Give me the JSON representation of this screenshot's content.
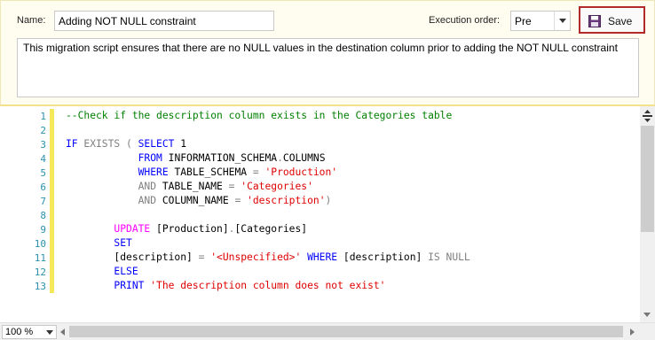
{
  "form": {
    "name_label": "Name:",
    "name_value": "Adding NOT NULL constraint",
    "exec_label": "Execution order:",
    "exec_value": "Pre",
    "save_label": "Save",
    "description": "This migration script ensures that there are no NULL values in the destination column prior to adding the NOT NULL constraint"
  },
  "editor": {
    "zoom": "100 %",
    "lines": [
      {
        "n": "1",
        "tokens": [
          {
            "c": "cmt",
            "t": "--Check if the description column exists in the Categories table"
          }
        ]
      },
      {
        "n": "2",
        "tokens": []
      },
      {
        "n": "3",
        "tokens": [
          {
            "c": "kw",
            "t": "IF "
          },
          {
            "c": "gray",
            "t": "EXISTS ( "
          },
          {
            "c": "kw",
            "t": "SELECT "
          },
          {
            "c": "plain",
            "t": "1"
          }
        ]
      },
      {
        "n": "4",
        "tokens": [
          {
            "c": "plain",
            "t": "            "
          },
          {
            "c": "kw",
            "t": "FROM "
          },
          {
            "c": "plain",
            "t": "INFORMATION_SCHEMA"
          },
          {
            "c": "gray",
            "t": "."
          },
          {
            "c": "plain",
            "t": "COLUMNS"
          }
        ]
      },
      {
        "n": "5",
        "tokens": [
          {
            "c": "plain",
            "t": "            "
          },
          {
            "c": "kw",
            "t": "WHERE "
          },
          {
            "c": "plain",
            "t": "TABLE_SCHEMA "
          },
          {
            "c": "gray",
            "t": "= "
          },
          {
            "c": "str",
            "t": "'Production'"
          }
        ]
      },
      {
        "n": "6",
        "tokens": [
          {
            "c": "plain",
            "t": "            "
          },
          {
            "c": "gray",
            "t": "AND "
          },
          {
            "c": "plain",
            "t": "TABLE_NAME "
          },
          {
            "c": "gray",
            "t": "= "
          },
          {
            "c": "str",
            "t": "'Categories'"
          }
        ]
      },
      {
        "n": "7",
        "tokens": [
          {
            "c": "plain",
            "t": "            "
          },
          {
            "c": "gray",
            "t": "AND "
          },
          {
            "c": "plain",
            "t": "COLUMN_NAME "
          },
          {
            "c": "gray",
            "t": "= "
          },
          {
            "c": "str",
            "t": "'description'"
          },
          {
            "c": "gray",
            "t": ")"
          }
        ]
      },
      {
        "n": "8",
        "tokens": []
      },
      {
        "n": "9",
        "tokens": [
          {
            "c": "plain",
            "t": "        "
          },
          {
            "c": "fn",
            "t": "UPDATE "
          },
          {
            "c": "plain",
            "t": "[Production]"
          },
          {
            "c": "gray",
            "t": "."
          },
          {
            "c": "plain",
            "t": "[Categories]"
          }
        ]
      },
      {
        "n": "10",
        "tokens": [
          {
            "c": "plain",
            "t": "        "
          },
          {
            "c": "kw",
            "t": "SET"
          }
        ]
      },
      {
        "n": "11",
        "tokens": [
          {
            "c": "plain",
            "t": "        [description] "
          },
          {
            "c": "gray",
            "t": "= "
          },
          {
            "c": "str",
            "t": "'<Unspecified>' "
          },
          {
            "c": "kw",
            "t": "WHERE "
          },
          {
            "c": "plain",
            "t": "[description] "
          },
          {
            "c": "gray",
            "t": "IS NULL"
          }
        ]
      },
      {
        "n": "12",
        "tokens": [
          {
            "c": "plain",
            "t": "        "
          },
          {
            "c": "kw",
            "t": "ELSE"
          }
        ]
      },
      {
        "n": "13",
        "tokens": [
          {
            "c": "plain",
            "t": "        "
          },
          {
            "c": "kw",
            "t": "PRINT "
          },
          {
            "c": "str",
            "t": "'The description column does not exist'"
          }
        ]
      }
    ]
  }
}
